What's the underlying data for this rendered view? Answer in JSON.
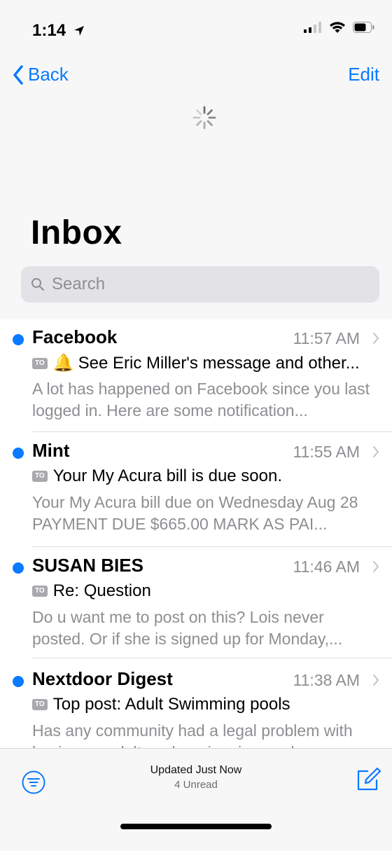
{
  "status_bar": {
    "time": "1:14",
    "icons": [
      "location-arrow-icon",
      "cellular-signal-icon",
      "wifi-icon",
      "battery-icon"
    ]
  },
  "nav": {
    "back_label": "Back",
    "edit_label": "Edit"
  },
  "title": "Inbox",
  "search": {
    "placeholder": "Search"
  },
  "messages": [
    {
      "sender": "Facebook",
      "time": "11:57 AM",
      "badge": "TO",
      "has_bell": true,
      "subject": "See Eric Miller's message and other...",
      "preview": "A lot has happened on Facebook since you last logged in. Here are some notification...",
      "unread": true
    },
    {
      "sender": "Mint",
      "time": "11:55 AM",
      "badge": "TO",
      "has_bell": false,
      "subject": "Your My Acura bill is due soon.",
      "preview": "Your My Acura bill due on Wednesday Aug 28 PAYMENT DUE $665.00 MARK AS PAI...",
      "unread": true
    },
    {
      "sender": "SUSAN BIES",
      "time": "11:46 AM",
      "badge": "TO",
      "has_bell": false,
      "subject": "Re: Question",
      "preview": "Do u want me to post on this? Lois never posted. Or if she is signed up for Monday,...",
      "unread": true
    },
    {
      "sender": "Nextdoor Digest",
      "time": "11:38 AM",
      "badge": "TO",
      "has_bell": false,
      "subject": "Top post: Adult Swimming pools",
      "preview": "Has any community had a legal problem with having an adults only swimming pool...",
      "unread": true
    }
  ],
  "toolbar": {
    "updated": "Updated Just Now",
    "unread": "4 Unread"
  },
  "colors": {
    "accent": "#0a7aff",
    "secondary_text": "#8e8e93",
    "badge": "#a8a8ad"
  }
}
